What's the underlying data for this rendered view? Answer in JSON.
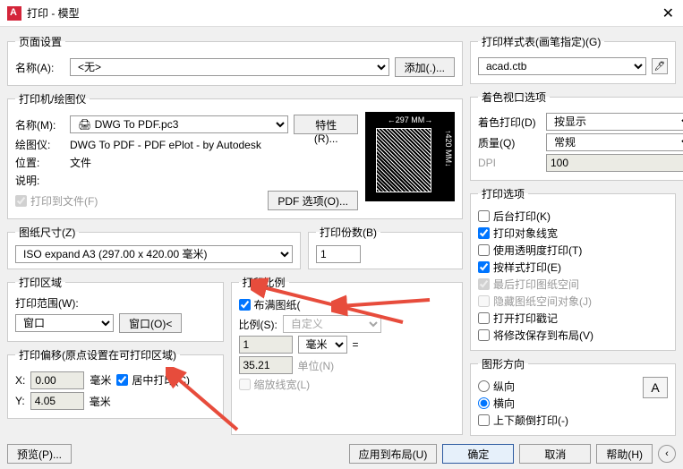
{
  "titlebar": {
    "title": "打印 - 模型"
  },
  "pageSetup": {
    "legend": "页面设置",
    "nameLabel": "名称(A):",
    "nameValue": "<无>",
    "addBtn": "添加(.)..."
  },
  "printer": {
    "legend": "打印机/绘图仪",
    "nameLabel": "名称(M):",
    "nameValue": "🖨 DWG To PDF.pc3",
    "propsBtn": "特性(R)...",
    "plotterLabel": "绘图仪:",
    "plotterValue": "DWG To PDF - PDF ePlot - by Autodesk",
    "locationLabel": "位置:",
    "locationValue": "文件",
    "descLabel": "说明:",
    "plotToFile": "打印到文件(F)",
    "pdfBtn": "PDF 选项(O)...",
    "previewTop": "297 MM",
    "previewRight": "420 MM"
  },
  "paperSize": {
    "legend": "图纸尺寸(Z)",
    "value": "ISO expand A3 (297.00 x 420.00 毫米)"
  },
  "copies": {
    "legend": "打印份数(B)",
    "value": "1"
  },
  "area": {
    "legend": "打印区域",
    "rangeLabel": "打印范围(W):",
    "rangeValue": "窗口",
    "windowBtn": "窗口(O)<"
  },
  "scale": {
    "legend": "打印比例",
    "fit": "布满图纸(",
    "ratioLabel": "比例(S):",
    "ratioValue": "自定义",
    "unit1": "1",
    "unitSel": "毫米",
    "eq": "=",
    "unit2": "35.21",
    "unitLabel": "单位(N)",
    "scaleLine": "缩放线宽(L)"
  },
  "offset": {
    "legend": "打印偏移(原点设置在可打印区域)",
    "xLabel": "X:",
    "xValue": "0.00",
    "yLabel": "Y:",
    "yValue": "4.05",
    "unit": "毫米",
    "center": "居中打印(C)"
  },
  "styleTable": {
    "legend": "打印样式表(画笔指定)(G)",
    "value": "acad.ctb"
  },
  "shaded": {
    "legend": "着色视口选项",
    "shadeLabel": "着色打印(D)",
    "shadeValue": "按显示",
    "qualityLabel": "质量(Q)",
    "qualityValue": "常规",
    "dpiLabel": "DPI",
    "dpiValue": "100"
  },
  "options": {
    "legend": "打印选项",
    "bg": "后台打印(K)",
    "lineweight": "打印对象线宽",
    "transparency": "使用透明度打印(T)",
    "styles": "按样式打印(E)",
    "paperLast": "最后打印图纸空间",
    "hide": "隐藏图纸空间对象(J)",
    "stamp": "打开打印戳记",
    "save": "将修改保存到布局(V)"
  },
  "orient": {
    "legend": "图形方向",
    "portrait": "纵向",
    "landscape": "横向",
    "upside": "上下颠倒打印(-)",
    "icon": "A"
  },
  "footer": {
    "preview": "预览(P)...",
    "apply": "应用到布局(U)",
    "ok": "确定",
    "cancel": "取消",
    "help": "帮助(H)"
  }
}
